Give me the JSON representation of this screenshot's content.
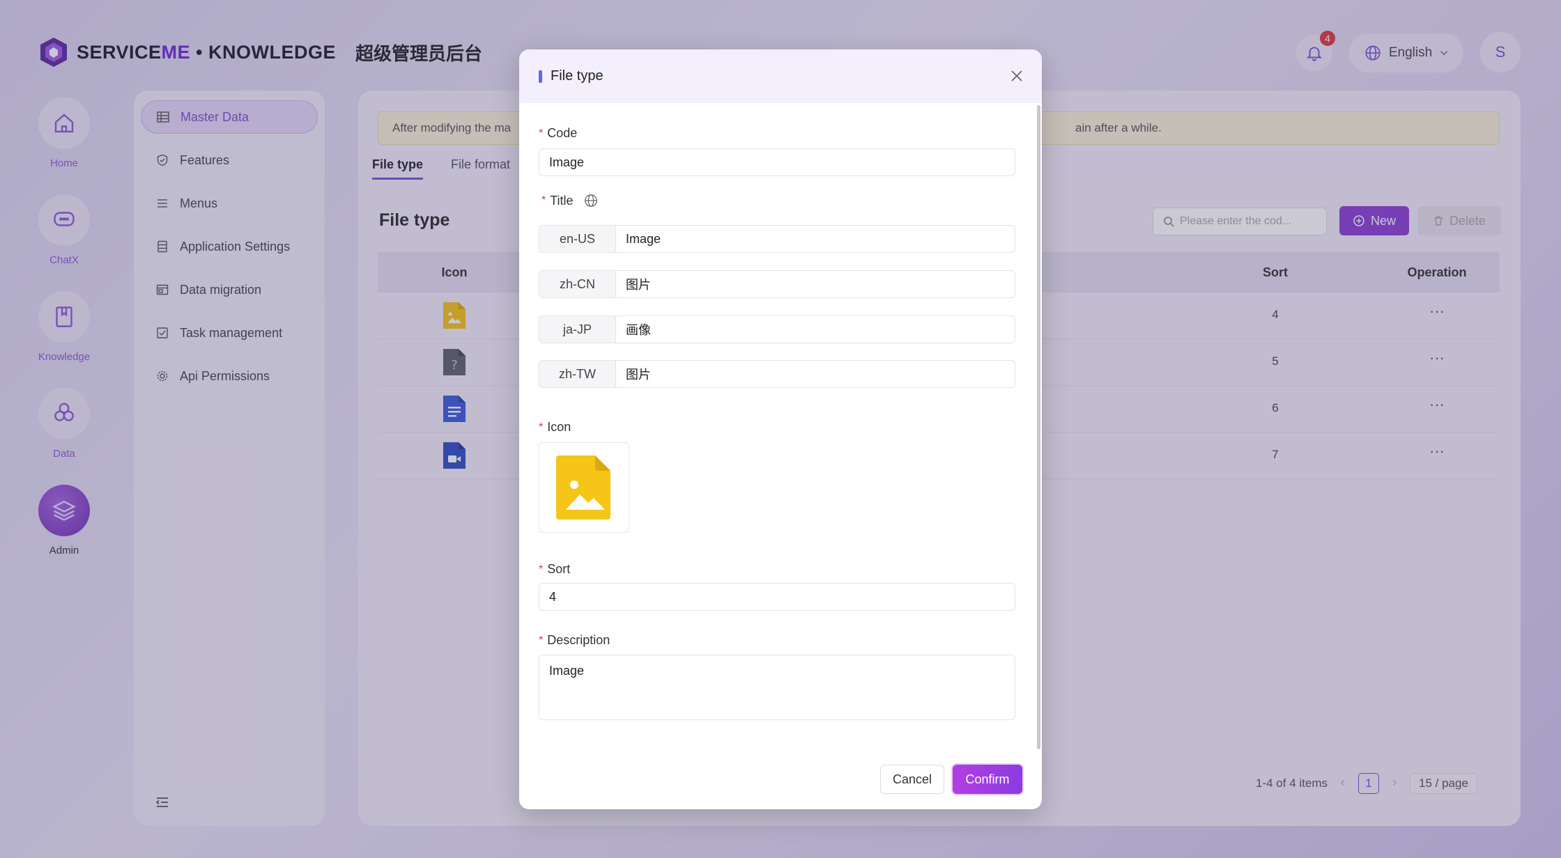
{
  "header": {
    "brand_service": "SERVICE",
    "brand_me": "ME",
    "brand_sep": " • ",
    "brand_knowledge": "KNOWLEDGE",
    "brand_sub": "超级管理员后台",
    "notification_count": "4",
    "language": "English",
    "avatar_initial": "S"
  },
  "rail": {
    "items": [
      {
        "label": "Home",
        "icon": "home-icon"
      },
      {
        "label": "ChatX",
        "icon": "chat-icon"
      },
      {
        "label": "Knowledge",
        "icon": "book-icon"
      },
      {
        "label": "Data",
        "icon": "hexagons-icon"
      },
      {
        "label": "Admin",
        "icon": "layers-icon"
      }
    ],
    "active": "Admin"
  },
  "sidemenu": {
    "items": [
      {
        "label": "Master Data",
        "icon": "table-icon"
      },
      {
        "label": "Features",
        "icon": "shield-check-icon"
      },
      {
        "label": "Menus",
        "icon": "list-icon"
      },
      {
        "label": "Application Settings",
        "icon": "server-icon"
      },
      {
        "label": "Data migration",
        "icon": "window-icon"
      },
      {
        "label": "Task management",
        "icon": "checkbox-icon"
      },
      {
        "label": "Api Permissions",
        "icon": "gear-icon"
      }
    ],
    "active": "Master Data"
  },
  "main": {
    "notice_start": "After modifying the ma",
    "notice_end": "ain after a while.",
    "tabs": [
      {
        "label": "File type"
      },
      {
        "label": "File format"
      }
    ],
    "active_tab": "File type",
    "section_title": "File type",
    "search_placeholder": "Please enter the cod...",
    "new_label": "New",
    "delete_label": "Delete",
    "columns": {
      "icon": "Icon",
      "sort": "Sort",
      "operation": "Operation"
    },
    "rows": [
      {
        "icon": "image-file-icon",
        "sort": "4",
        "op": "···"
      },
      {
        "icon": "unknown-file-icon",
        "sort": "5",
        "op": "···"
      },
      {
        "icon": "document-file-icon",
        "sort": "6",
        "op": "···"
      },
      {
        "icon": "video-file-icon",
        "sort": "7",
        "op": "···"
      }
    ],
    "pagination": {
      "summary": "1-4 of 4 items",
      "current": "1",
      "page_size": "15 / page"
    }
  },
  "modal": {
    "title": "File type",
    "code_label": "Code",
    "code_value": "Image",
    "title_label": "Title",
    "titles": [
      {
        "lang": "en-US",
        "value": "Image"
      },
      {
        "lang": "zh-CN",
        "value": "图片"
      },
      {
        "lang": "ja-JP",
        "value": "画像"
      },
      {
        "lang": "zh-TW",
        "value": "图片"
      }
    ],
    "icon_label": "Icon",
    "sort_label": "Sort",
    "sort_value": "4",
    "description_label": "Description",
    "description_value": "Image",
    "cancel_label": "Cancel",
    "confirm_label": "Confirm"
  },
  "colors": {
    "accent": "#8b3fd6",
    "required": "#e0383e",
    "file_image": "#f5c518",
    "file_unknown": "#5f6368",
    "file_doc": "#3b5bdb"
  }
}
